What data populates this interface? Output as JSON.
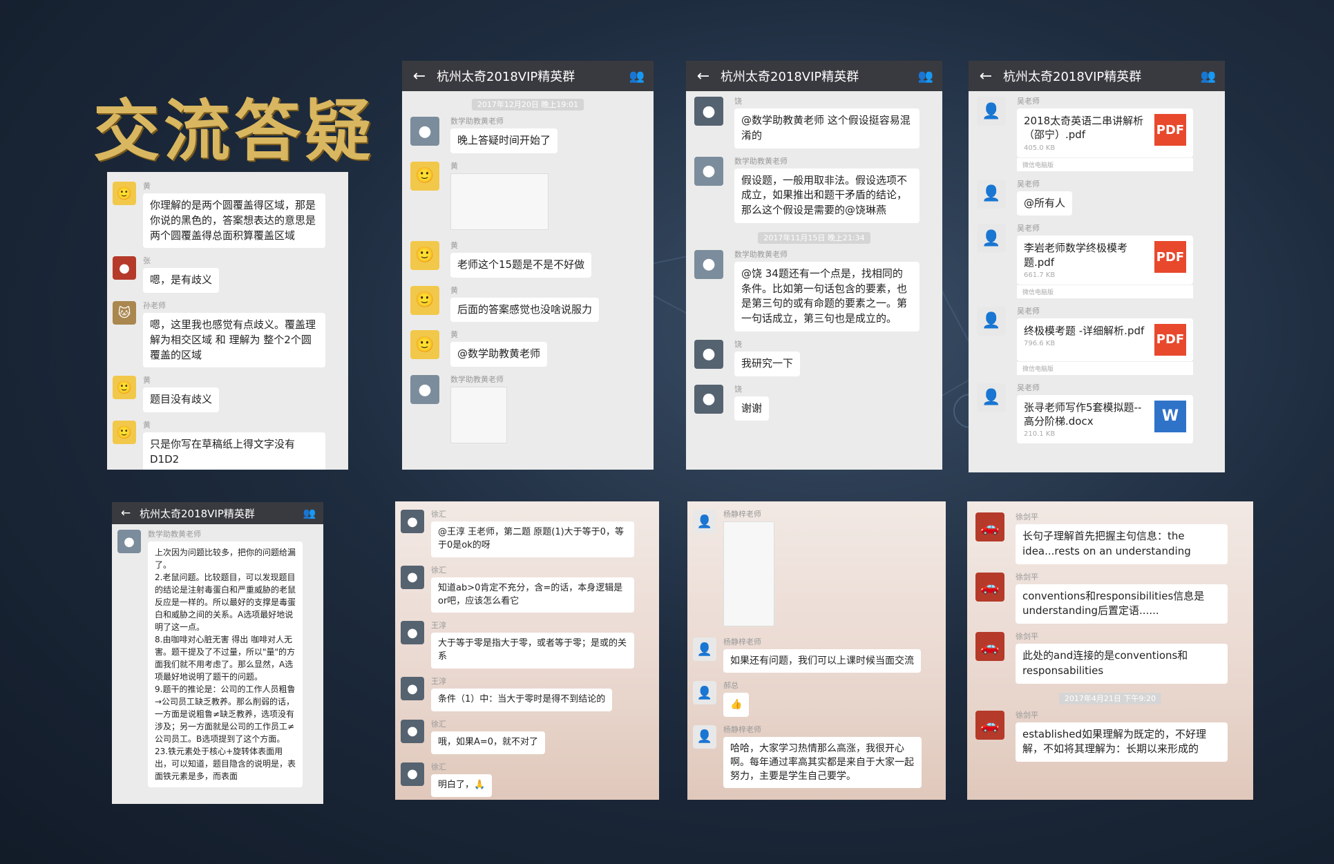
{
  "page_title": "交流答疑",
  "colors": {
    "title_gold": "#d9b660",
    "titlebar": "#393a3f",
    "pdf_red": "#e8492d",
    "word_blue": "#2f73c9"
  },
  "group_title": "杭州太奇2018VIP精英群",
  "panels": {
    "p1": {
      "messages": [
        {
          "name": "黄",
          "avatar": "a0",
          "text": "你理解的是两个圆覆盖得区域，那是你说的黑色的，答案想表达的意思是两个圆覆盖得总面积算覆盖区域"
        },
        {
          "name": "张",
          "avatar": "a3",
          "text": "嗯，是有歧义"
        },
        {
          "name": "孙老师",
          "avatar": "a4",
          "text": "嗯，这里我也感觉有点歧义。覆盖理解为相交区域 和 理解为 整个2个圆覆盖的区域"
        },
        {
          "name": "黄",
          "avatar": "a0",
          "text": "题目没有歧义"
        },
        {
          "name": "黄",
          "avatar": "a0",
          "text": "只是你写在草稿纸上得文字没有D1D2"
        }
      ]
    },
    "p2": {
      "timestamp": "2017年12月20日 晚上19:01",
      "messages": [
        {
          "name": "数学助教黄老师",
          "avatar": "a1",
          "text": "晚上答疑时间开始了"
        },
        {
          "name": "黄",
          "avatar": "a0",
          "text": ""
        },
        {
          "name": "黄",
          "avatar": "a0",
          "text": "老师这个15题是不是不好做"
        },
        {
          "name": "黄",
          "avatar": "a0",
          "text": "后面的答案感觉也没啥说服力"
        },
        {
          "name": "黄",
          "avatar": "a0",
          "text": "@数学助教黄老师"
        },
        {
          "name": "数学助教黄老师",
          "avatar": "a1",
          "text": ""
        }
      ]
    },
    "p3": {
      "timestamp": "2017年11月15日 晚上21:34",
      "messages": [
        {
          "name": "饶",
          "avatar": "a5",
          "text": "@数学助教黄老师 这个假设挺容易混淆的"
        },
        {
          "name": "数学助教黄老师",
          "avatar": "a1",
          "text": "假设题，一般用取非法。假设选项不成立，如果推出和题干矛盾的结论，那么这个假设是需要的@饶琳燕"
        },
        {
          "name": "数学助教黄老师",
          "avatar": "a1",
          "text": "@饶 34题还有一个点是，找相同的条件。比如第一句话包含的要素，也是第三句的或有命题的要素之一。第一句话成立，第三句也是成立的。"
        },
        {
          "name": "饶",
          "avatar": "a5",
          "text": "我研究一下"
        },
        {
          "name": "饶",
          "avatar": "a5",
          "text": "谢谢"
        }
      ]
    },
    "p4": {
      "messages": [
        {
          "name": "吴老师",
          "file": "2018太奇英语二串讲解析（邵宁）.pdf",
          "size": "405.0 KB",
          "icon": "PDF",
          "src": "微信电脑版"
        },
        {
          "name": "吴老师",
          "text": "@所有人"
        },
        {
          "name": "吴老师",
          "file": "李岩老师数学终极模考题.pdf",
          "size": "661.7 KB",
          "icon": "PDF",
          "src": "微信电脑版"
        },
        {
          "name": "吴老师",
          "file": "终极模考题 -详细解析.pdf",
          "size": "796.6 KB",
          "icon": "PDF",
          "src": "微信电脑版"
        },
        {
          "name": "吴老师",
          "file": "张寻老师写作5套模拟题--高分阶梯.docx",
          "size": "210.1 KB",
          "icon": "W",
          "src": ""
        }
      ]
    },
    "p5": {
      "messages": [
        {
          "name": "数学助教黄老师",
          "avatar": "a1",
          "text": "上次因为问题比较多，把你的问题给漏了。\n2.老鼠问题。比较题目，可以发现题目的结论是注射毒蛋白和严重威胁的老鼠反应是一样的。所以最好的支撑是毒蛋白和威胁之间的关系。A选项最好地说明了这一点。\n8.由咖啡对心脏无害 得出 咖啡对人无害。题干提及了不过量，所以\"量\"的方面我们就不用考虑了。那么显然，A选项最好地说明了题干的问题。\n9.题干的推论是：公司的工作人员粗鲁→公司员工缺乏教养。那么削弱的话，一方面是说粗鲁≠缺乏教养，选项没有涉及；另一方面就是公司的工作员工≠公司员工。B选项提到了这个方面。\n23.铁元素处于核心+旋转体表面用出，可以知道，题目隐含的说明是，表面铁元素是多，而表面"
        }
      ]
    },
    "p6": {
      "messages": [
        {
          "name": "徐汇",
          "avatar": "a5",
          "text": "@王淳 王老师，第二题 原题(1)大于等于0，等于0是ok的呀"
        },
        {
          "name": "徐汇",
          "avatar": "a5",
          "text": "知道ab>0肯定不充分，含=的话，本身逻辑是or吧，应该怎么看它"
        },
        {
          "name": "王淳",
          "avatar": "a5",
          "text": "大于等于零是指大于零，或者等于零；是或的关系"
        },
        {
          "name": "王淳",
          "avatar": "a5",
          "text": "条件（1）中：当大于零时是得不到结论的"
        },
        {
          "name": "徐汇",
          "avatar": "a5",
          "text": "哦，如果A=0，就不对了"
        },
        {
          "name": "徐汇",
          "avatar": "a5",
          "text": "明白了，🙏"
        }
      ]
    },
    "p7": {
      "messages": [
        {
          "name": "杨静梓老师",
          "avatar": "a2",
          "text": ""
        },
        {
          "name": "杨静梓老师",
          "avatar": "a2",
          "text": "如果还有问题，我们可以上课时候当面交流"
        },
        {
          "name": "郝总",
          "avatar": "a2",
          "text": "👍"
        },
        {
          "name": "杨静梓老师",
          "avatar": "a2",
          "text": "哈哈，大家学习热情那么高涨，我很开心啊。每年通过率高其实都是来自于大家一起努力，主要是学生自己要学。"
        }
      ]
    },
    "p8": {
      "timestamp": "2017年4月21日 下午9:20",
      "messages": [
        {
          "name": "徐剑平",
          "avatar": "a3",
          "text": "长句子理解首先把握主句信息：the idea...rests on an understanding"
        },
        {
          "name": "徐剑平",
          "avatar": "a3",
          "text": "conventions和responsibilities信息是understanding后置定语......"
        },
        {
          "name": "徐剑平",
          "avatar": "a3",
          "text": "此处的and连接的是conventions和responsabilities"
        },
        {
          "name": "徐剑平",
          "avatar": "a3",
          "text": "established如果理解为既定的，不好理解，不如将其理解为：长期以来形成的"
        }
      ]
    }
  }
}
